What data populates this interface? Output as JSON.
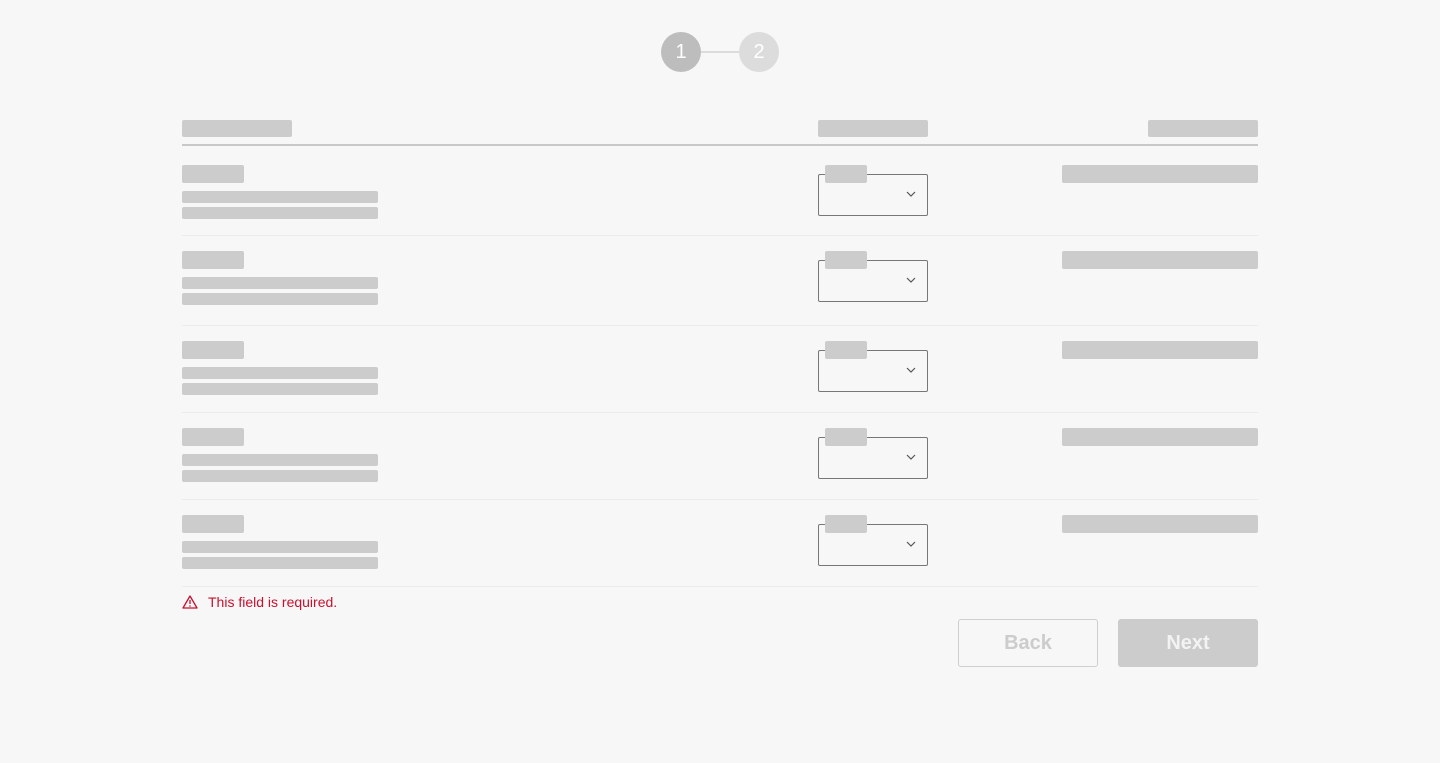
{
  "stepper": {
    "steps": [
      {
        "label": "1",
        "state": "active"
      },
      {
        "label": "2",
        "state": "inactive"
      }
    ]
  },
  "table": {
    "columns": [
      "",
      "",
      ""
    ],
    "rows": [
      {
        "title": "",
        "description": "",
        "select_label": "",
        "select_value": "",
        "value": ""
      },
      {
        "title": "",
        "description": "",
        "select_label": "",
        "select_value": "",
        "value": ""
      },
      {
        "title": "",
        "description": "",
        "select_label": "",
        "select_value": "",
        "value": ""
      },
      {
        "title": "",
        "description": "",
        "select_label": "",
        "select_value": "",
        "value": ""
      },
      {
        "title": "",
        "description": "",
        "select_label": "",
        "select_value": "",
        "value": ""
      }
    ]
  },
  "error": {
    "icon": "warning-triangle-icon",
    "message": "This field is required.",
    "color": "#c8102e"
  },
  "actions": {
    "back_label": "Back",
    "next_label": "Next"
  }
}
